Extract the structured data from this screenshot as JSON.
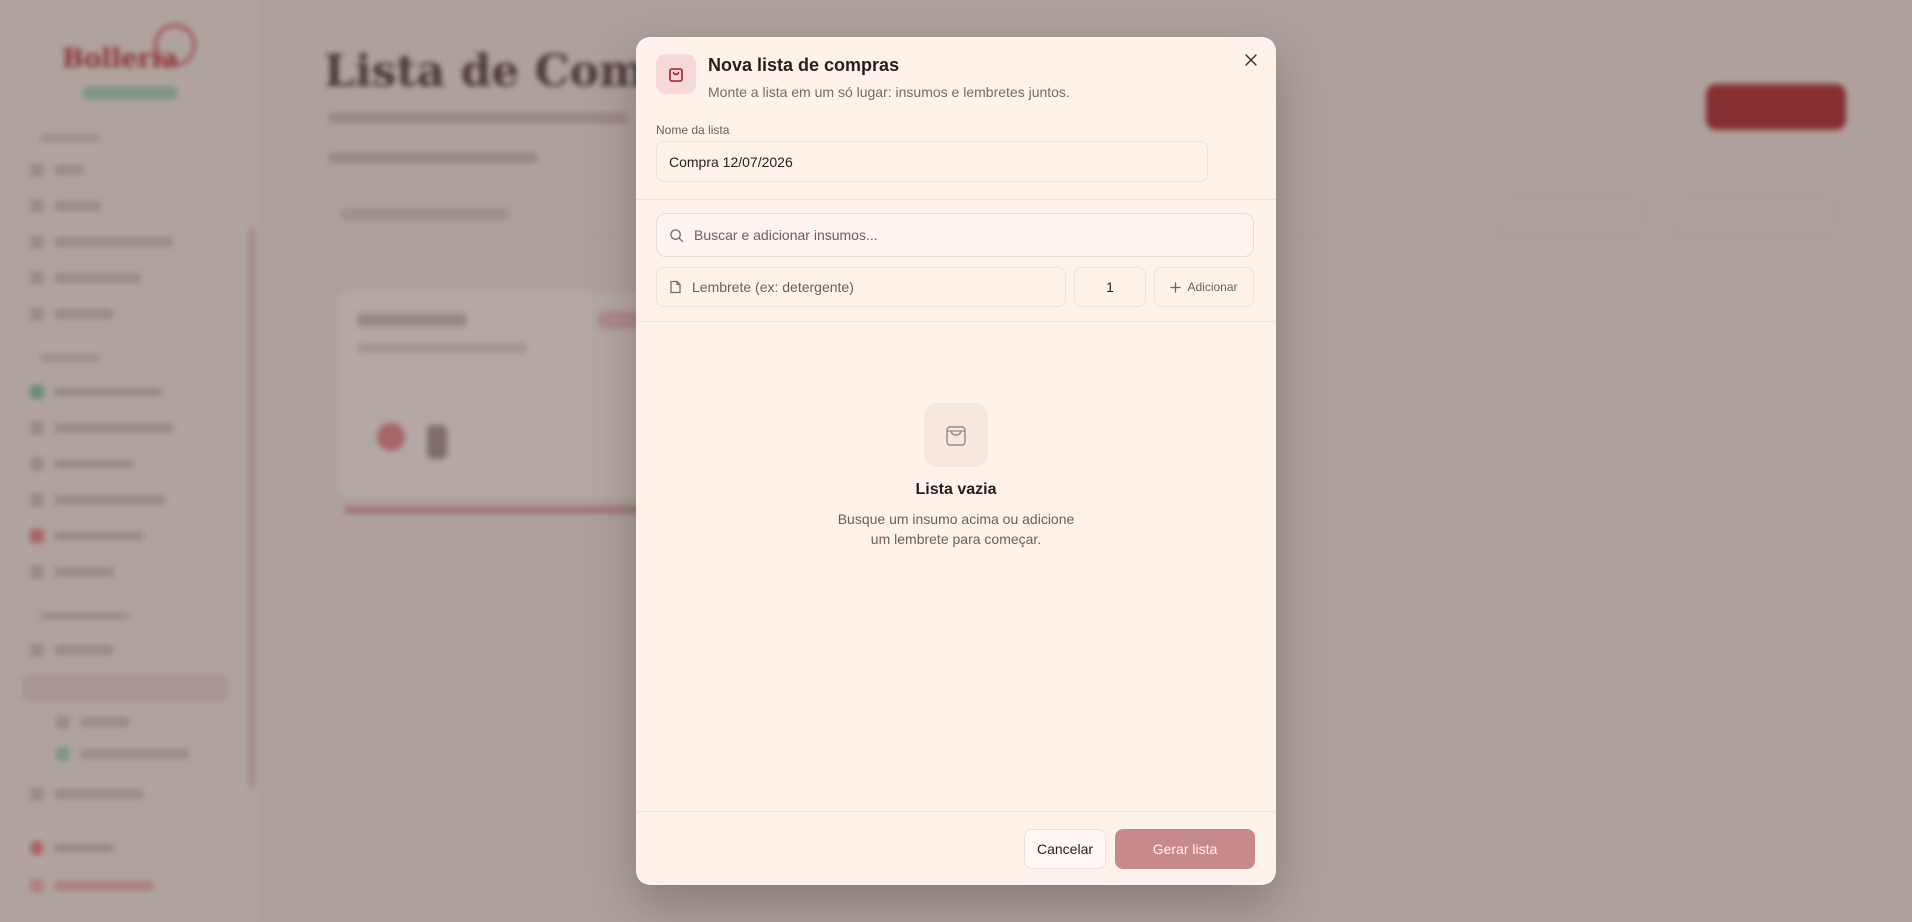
{
  "background": {
    "brand": "Bolleria",
    "page_title": "Lista de Compras"
  },
  "modal": {
    "title": "Nova lista de compras",
    "subtitle": "Monte a lista em um só lugar: insumos e lembretes juntos.",
    "list_name_label": "Nome da lista",
    "list_name_value": "Compra 12/07/2026",
    "search_placeholder": "Buscar e adicionar insumos...",
    "reminder_placeholder": "Lembrete (ex: detergente)",
    "quantity_value": "1",
    "add_button": "Adicionar",
    "empty_title": "Lista vazia",
    "empty_description": "Busque um insumo acima ou adicione um lembrete para começar.",
    "cancel_button": "Cancelar",
    "submit_button": "Gerar lista"
  },
  "icons": {
    "header": "shopping-bag-icon",
    "close": "close-icon",
    "search": "search-icon",
    "reminder": "note-icon",
    "add": "plus-icon",
    "empty": "shopping-bag-icon"
  },
  "colors": {
    "modal_bg": "#fff2ea",
    "accent": "#b3202b",
    "submit_disabled": "#c8898a",
    "overlay": "#5a4642"
  }
}
